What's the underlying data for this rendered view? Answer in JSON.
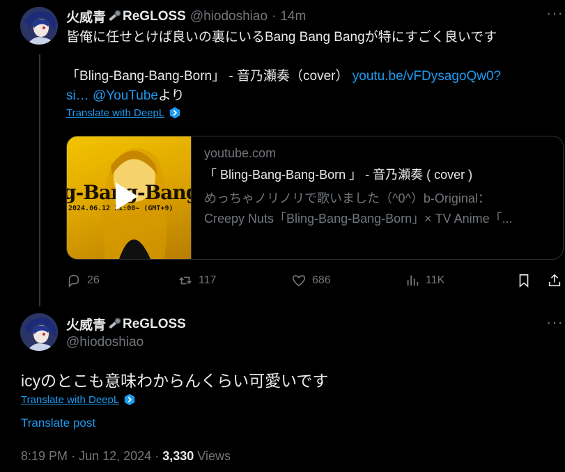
{
  "reply_tweet": {
    "author_name": "火威青",
    "author_badge": "ReGLOSS",
    "handle": "@hiodoshiao",
    "separator": "·",
    "time": "14m",
    "line1": "皆俺に任せとけば良いの裏にいるBang Bang Bangが特にすごく良いです",
    "line2_text": "「Bling-Bang-Bang-Born」 - 音乃瀬奏（cover） ",
    "line2_link": "youtu.be/vFDysagoQw0?",
    "line3_link_a": "si…",
    "line3_space": " ",
    "line3_link_b": "@YouTube",
    "line3_tail": "より",
    "translate_label": "Translate with DeepL",
    "card": {
      "thumb_text": "g-Bang-Bang-B",
      "thumb_date": "2024.06.12 21:00~ (GMT+9)",
      "domain": "youtube.com",
      "title": "「 Bling-Bang-Bang-Born 」 - 音乃瀬奏 ( cover )",
      "desc_line1": "めっちゃノリノリで歌いました（^0^）b-Original：",
      "desc_line2": "Creepy Nuts「Bling-Bang-Bang-Born」× TV Anime「..."
    },
    "actions": {
      "replies": "26",
      "reposts": "117",
      "likes": "686",
      "views": "11K"
    }
  },
  "main_tweet": {
    "author_name": "火威青",
    "author_badge": "ReGLOSS",
    "handle": "@hiodoshiao",
    "text": "icyのとこも意味わからんくらい可愛いです",
    "translate_label": "Translate with DeepL",
    "translate_post": "Translate post",
    "time": "8:19 PM",
    "sep": "·",
    "date": "Jun 12, 2024",
    "views_count": "3,330",
    "views_label": "Views"
  },
  "icons": [
    "microphone-emoji",
    "reply-icon",
    "repost-icon",
    "like-icon",
    "views-icon",
    "bookmark-icon",
    "share-icon",
    "more-icon",
    "deepl-icon",
    "play-icon"
  ],
  "colors": {
    "accent": "#1d9bf0",
    "muted": "#71767b",
    "text": "#e7e9ea",
    "bg": "#000000",
    "thumb": "#f2c400"
  }
}
